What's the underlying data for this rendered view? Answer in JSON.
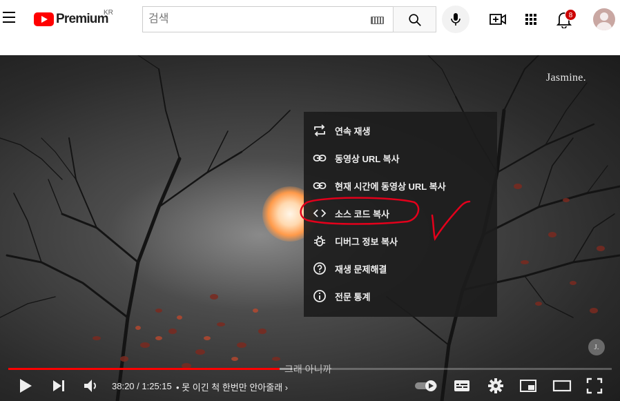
{
  "header": {
    "logo_text": "Premium",
    "region": "KR",
    "search_placeholder": "검색",
    "notification_count": "8"
  },
  "player": {
    "watermark": "Jasmine.",
    "channel_badge": "J.",
    "subtitle": "그래 아니까",
    "time_current": "38:20",
    "time_total": "1:25:15",
    "time_display": "38:20 / 1:25:15",
    "chapter": "• 못 이긴 척 한번만 안아줄래",
    "progress": 0.45,
    "buffered": 0.47
  },
  "context_menu": {
    "items": [
      {
        "label": "연속 재생",
        "icon": "loop-icon"
      },
      {
        "label": "동영상 URL 복사",
        "icon": "link-icon"
      },
      {
        "label": "현재 시간에 동영상 URL 복사",
        "icon": "link-icon"
      },
      {
        "label": "소스 코드 복사",
        "icon": "code-icon"
      },
      {
        "label": "디버그 정보 복사",
        "icon": "bug-icon"
      },
      {
        "label": "재생 문제해결",
        "icon": "help-icon"
      },
      {
        "label": "전문 통계",
        "icon": "info-icon"
      }
    ]
  },
  "colors": {
    "brand": "#ff0000",
    "annotation": "#e3001b",
    "menu_bg": "#1c1c1c"
  }
}
